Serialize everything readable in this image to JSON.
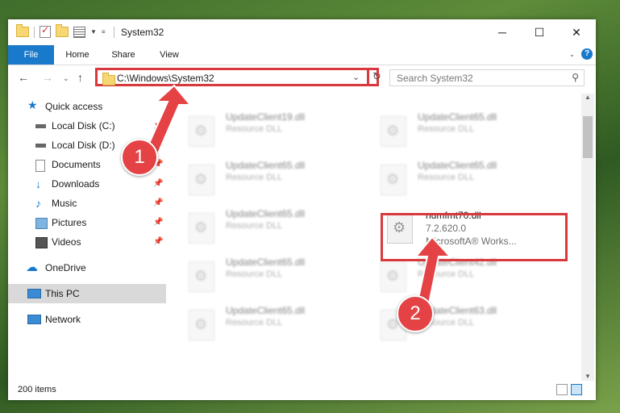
{
  "window": {
    "title": "System32",
    "controls": [
      "minimize-icon",
      "maximize-icon",
      "close-icon"
    ]
  },
  "ribbon": {
    "tabs": [
      "File",
      "Home",
      "Share",
      "View"
    ]
  },
  "address": {
    "path": "C:\\Windows\\System32"
  },
  "search": {
    "placeholder": "Search System32"
  },
  "nav": {
    "items": [
      {
        "label": "Quick access"
      },
      {
        "label": "Local Disk (C:)"
      },
      {
        "label": "Local Disk (D:)"
      },
      {
        "label": "Documents"
      },
      {
        "label": "Downloads"
      },
      {
        "label": "Music"
      },
      {
        "label": "Pictures"
      },
      {
        "label": "Videos"
      },
      {
        "label": "OneDrive"
      },
      {
        "label": "This PC"
      },
      {
        "label": "Network"
      }
    ]
  },
  "files": [
    {
      "name": "UpdateClient19.dll",
      "desc": "Resource DLL"
    },
    {
      "name": "UpdateClient65.dll",
      "desc": "Resource DLL"
    },
    {
      "name": "UpdateClient65.dll",
      "desc": "Resource DLL"
    },
    {
      "name": "UpdateClient65.dll",
      "desc": "Resource DLL"
    },
    {
      "name": "UpdateClient65.dll",
      "desc": "Resource DLL"
    },
    {
      "name": "numfmt70.dll",
      "desc": "7.2.620.0",
      "desc2": "MicrosoftA® Works..."
    },
    {
      "name": "UpdateClient65.dll",
      "desc": "Resource DLL"
    },
    {
      "name": "UpdateClient42.dll",
      "desc": "Resource DLL"
    },
    {
      "name": "UpdateClient65.dll",
      "desc": "Resource DLL"
    },
    {
      "name": "UpdateClient63.dll",
      "desc": "Resource DLL"
    }
  ],
  "status": {
    "count": "200 items"
  },
  "annotations": {
    "one": "1",
    "two": "2"
  },
  "colors": {
    "accent": "#1979ca",
    "highlight": "#d9393c"
  }
}
